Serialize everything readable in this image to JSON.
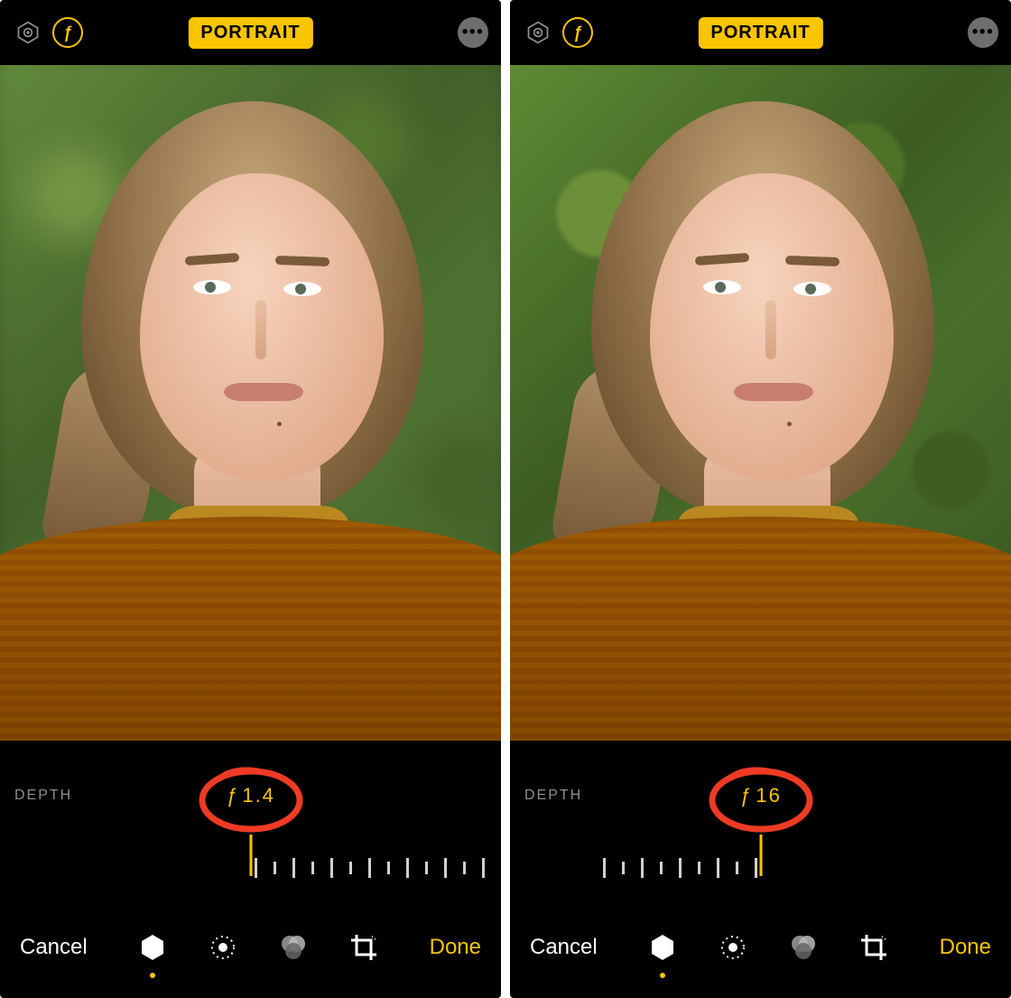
{
  "panes": [
    {
      "mode_label": "PORTRAIT",
      "depth_label": "DEPTH",
      "depth_value": "1.4",
      "depth_prefix": "ƒ",
      "background_blurred": true,
      "ruler_side": "right",
      "cancel_label": "Cancel",
      "done_label": "Done",
      "annotation": "circled"
    },
    {
      "mode_label": "PORTRAIT",
      "depth_label": "DEPTH",
      "depth_value": "16",
      "depth_prefix": "ƒ",
      "background_blurred": false,
      "ruler_side": "left",
      "cancel_label": "Cancel",
      "done_label": "Done",
      "annotation": "circled"
    }
  ],
  "colors": {
    "accent": "#f9c400",
    "annotation": "#ef3b24"
  },
  "tools": {
    "lighting": "portrait-lighting",
    "adjust": "adjust",
    "filters": "filters",
    "crop": "crop",
    "active": "portrait-lighting"
  }
}
